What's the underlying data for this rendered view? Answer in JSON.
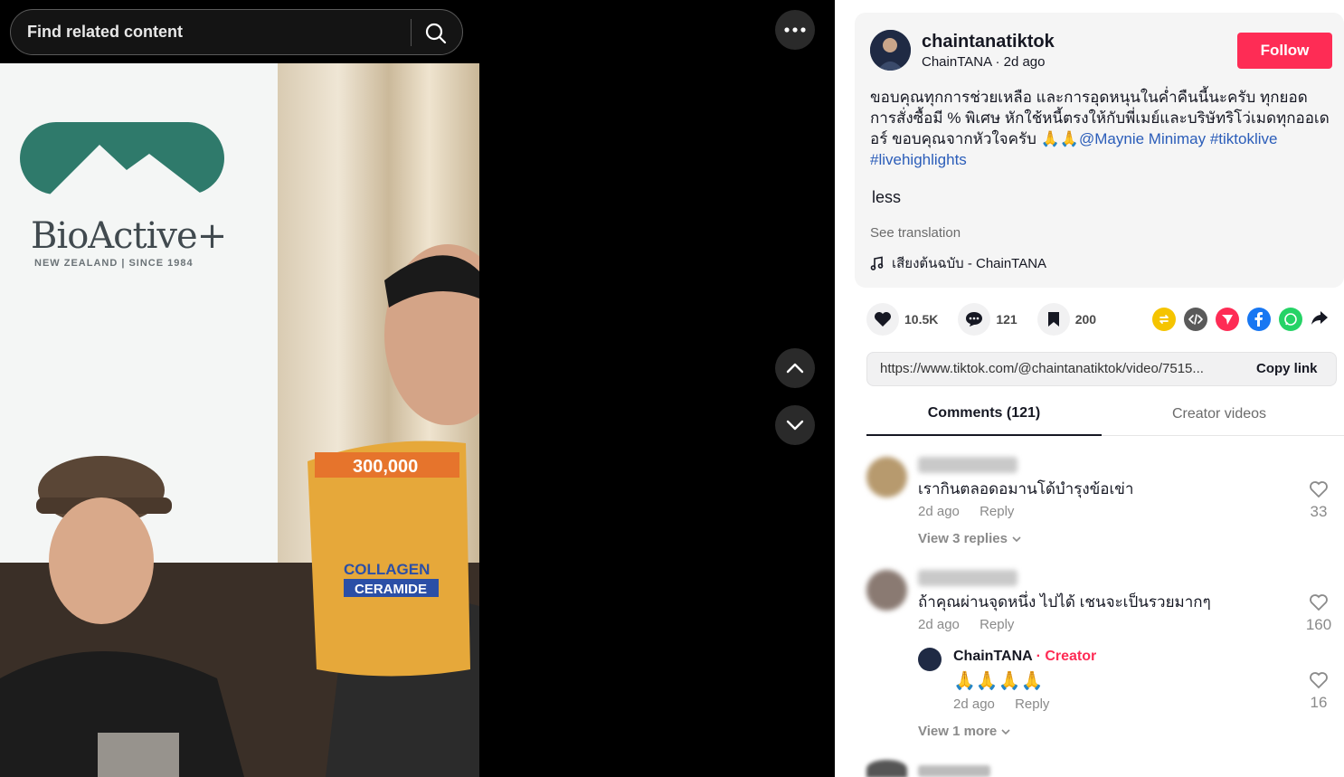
{
  "search": {
    "placeholder": "Find related content"
  },
  "video": {
    "brand_name": "BioActive+",
    "brand_sub": "NEW ZEALAND | SINCE 1984",
    "bag_top": "300,000",
    "bag_line1": "COLLAGEN",
    "bag_line2": "CERAMIDE"
  },
  "post": {
    "username": "chaintanatiktok",
    "display_name": "ChainTANA",
    "time": "2d ago",
    "follow_label": "Follow",
    "caption_text": "ขอบคุณทุกการช่วยเหลือ และการอุดหนุนในค่ำคืนนี้นะครับ ทุกยอดการสั่งซื้อมี % พิเศษ หักใช้หนี้ตรงให้กับพี่เมย์และบริษัทริโว่เมดทุกออเดอร์ ขอบคุณจากหัวใจครับ 🙏🙏",
    "mention": "@Maynie Minimay",
    "tag1": "#tiktoklive",
    "tag2": "#livehighlights",
    "less_label": "less",
    "see_translation": "See translation",
    "music": "เสียงต้นฉบับ - ChainTANA"
  },
  "actions": {
    "likes": "10.5K",
    "comments": "121",
    "saves": "200"
  },
  "share_colors": {
    "repost": "#f5c400",
    "embed": "#5a5a5a",
    "send": "#fe2c55",
    "facebook": "#1877f2",
    "whatsapp": "#25d366"
  },
  "link": {
    "url": "https://www.tiktok.com/@chaintanatiktok/video/7515...",
    "copy_label": "Copy link"
  },
  "tabs": {
    "comments": "Comments (121)",
    "creator_videos": "Creator videos"
  },
  "comments": [
    {
      "text": "เรากินตลอดอมานโด้บำรุงข้อเข่า",
      "time": "2d ago",
      "reply": "Reply",
      "likes": "33",
      "view_replies": "View 3 replies"
    },
    {
      "text": "ถ้าคุณผ่านจุดหนึ่ง ไปได้ เชนจะเป็นรวยมากๆ",
      "time": "2d ago",
      "reply": "Reply",
      "likes": "160",
      "view_more": "View 1 more"
    }
  ],
  "creator_reply": {
    "name": "ChainTANA",
    "badge": "Creator",
    "text": "🙏🙏🙏🙏",
    "time": "2d ago",
    "reply": "Reply",
    "likes": "16"
  }
}
